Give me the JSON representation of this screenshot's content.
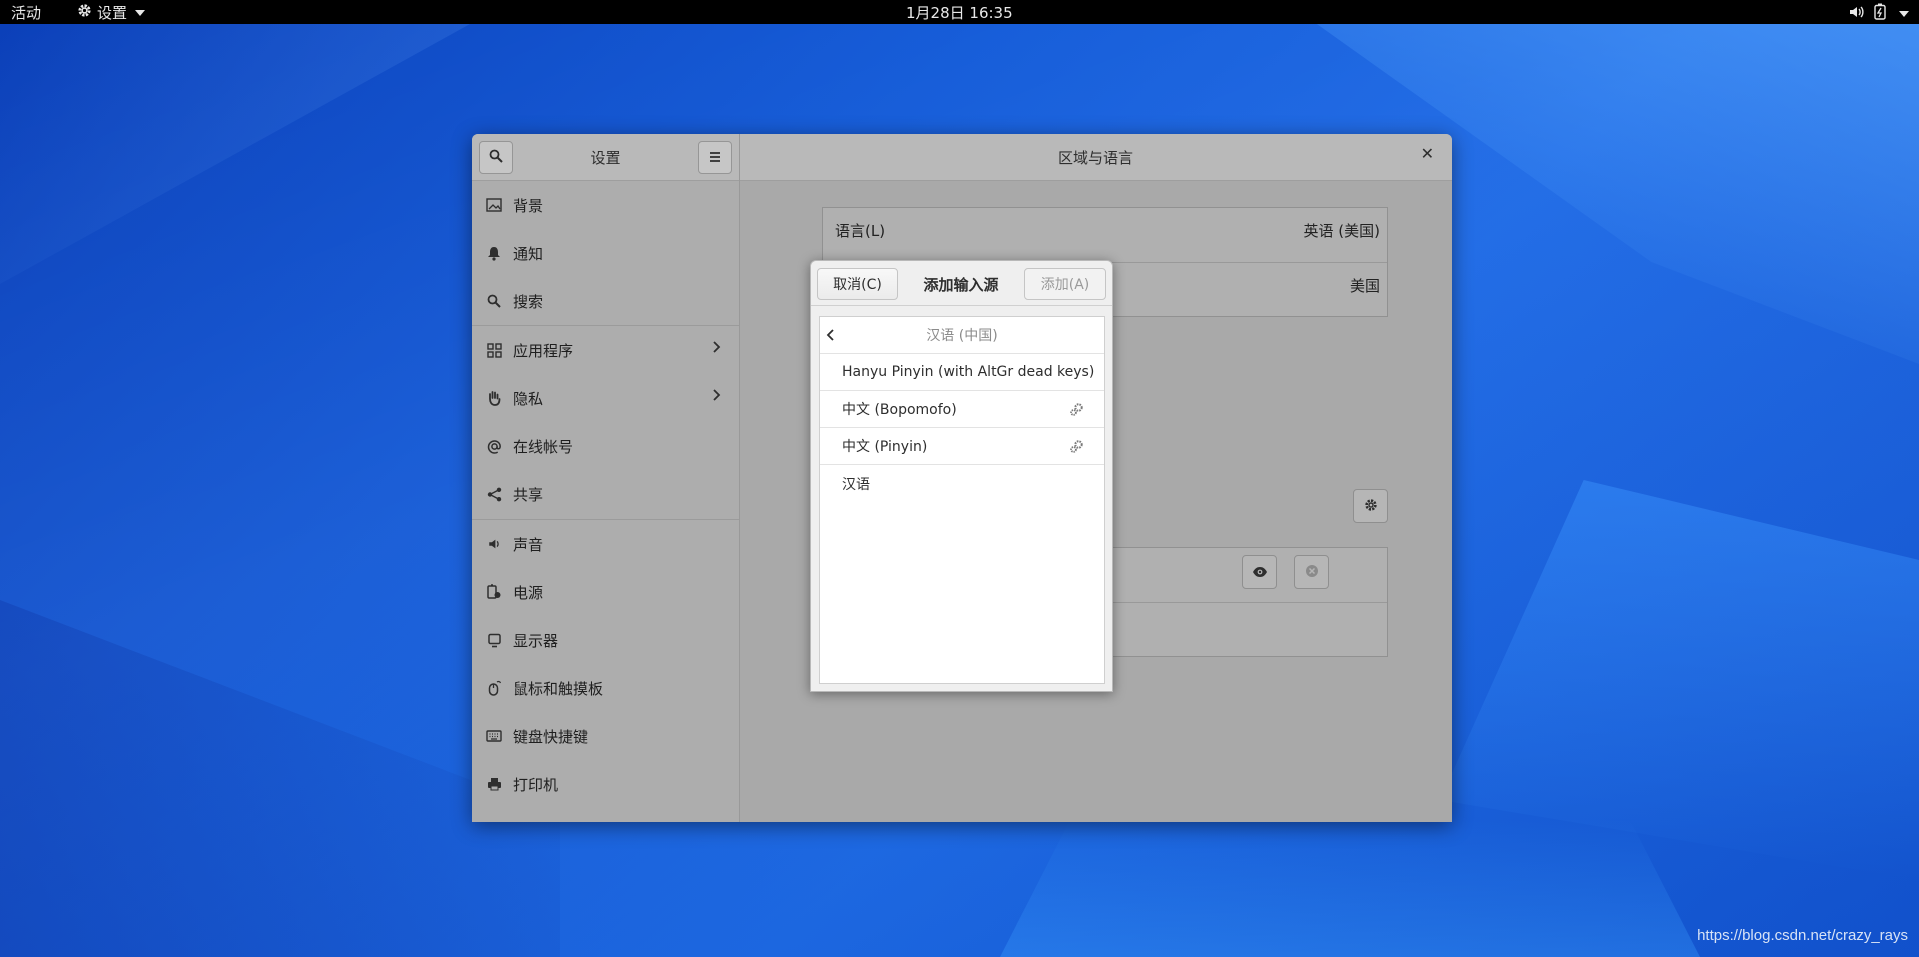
{
  "topbar": {
    "activities": "活动",
    "app_menu": "设置",
    "clock": "1月28日  16:35"
  },
  "window": {
    "sidebar_title": "设置",
    "panel_title": "区域与语言",
    "sidebar_items": [
      {
        "label": "背景",
        "icon": "image-icon"
      },
      {
        "label": "通知",
        "icon": "bell-icon"
      },
      {
        "label": "搜索",
        "icon": "search-icon"
      },
      {
        "label": "应用程序",
        "icon": "apps-grid-icon"
      },
      {
        "label": "隐私",
        "icon": "hand-icon"
      },
      {
        "label": "在线帐号",
        "icon": "at-icon"
      },
      {
        "label": "共享",
        "icon": "share-icon"
      },
      {
        "label": "声音",
        "icon": "speaker-icon"
      },
      {
        "label": "电源",
        "icon": "power-icon"
      },
      {
        "label": "显示器",
        "icon": "display-icon"
      },
      {
        "label": "鼠标和触摸板",
        "icon": "mouse-icon"
      },
      {
        "label": "键盘快捷键",
        "icon": "keyboard-icon"
      },
      {
        "label": "打印机",
        "icon": "printer-icon"
      }
    ],
    "main": {
      "language_label": "语言(L)",
      "language_value": "英语 (美国)",
      "formats_value": "美国"
    }
  },
  "dialog": {
    "cancel": "取消(C)",
    "title": "添加输入源",
    "add": "添加(A)",
    "list_header": "汉语 (中国)",
    "items": [
      {
        "label": "Hanyu Pinyin (with AltGr dead keys)",
        "has_settings": false
      },
      {
        "label": "中文 (Bopomofo)",
        "has_settings": true
      },
      {
        "label": "中文 (Pinyin)",
        "has_settings": true
      },
      {
        "label": "汉语",
        "has_settings": false
      }
    ]
  },
  "watermark": "https://blog.csdn.net/crazy_rays"
}
